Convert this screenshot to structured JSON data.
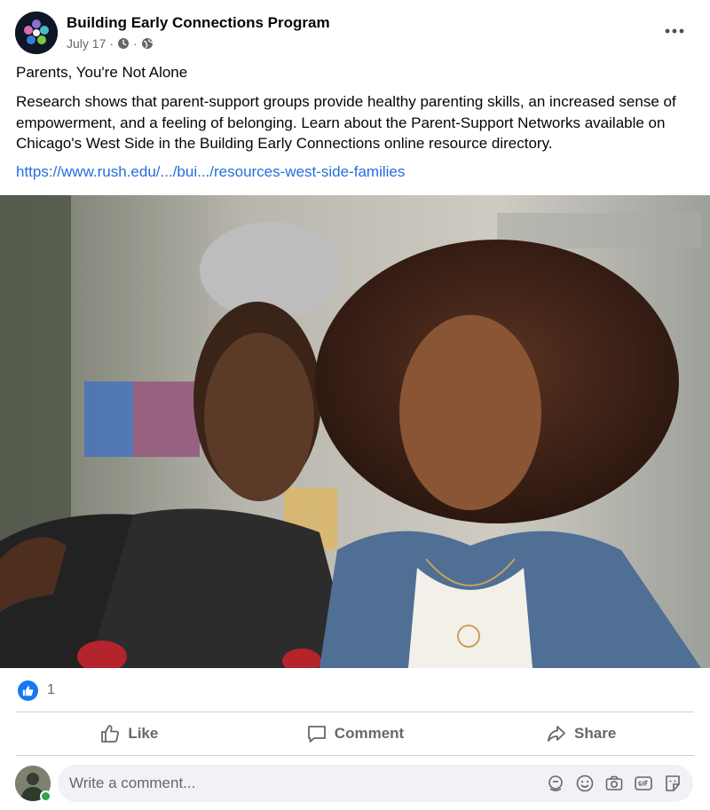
{
  "post": {
    "page_name": "Building Early Connections Program",
    "date": "July 17",
    "separator": "·",
    "title": "Parents, You're Not Alone",
    "body": "Research shows that parent-support groups provide healthy parenting skills, an increased sense of empowerment, and a feeling of belonging. Learn about the Parent-Support Networks available on Chicago's West Side in the Building Early Connections online resource directory.",
    "link_text": "https://www.rush.edu/.../bui.../resources-west-side-families"
  },
  "reactions": {
    "icon": "like-icon",
    "count": "1"
  },
  "actions": {
    "like_label": "Like",
    "comment_label": "Comment",
    "share_label": "Share"
  },
  "comment": {
    "placeholder": "Write a comment..."
  },
  "colors": {
    "link": "#216fdb",
    "like_blue": "#1877f2",
    "muted_text": "#65676b",
    "online_green": "#31a24c",
    "comment_bg": "#f0f2f5"
  }
}
